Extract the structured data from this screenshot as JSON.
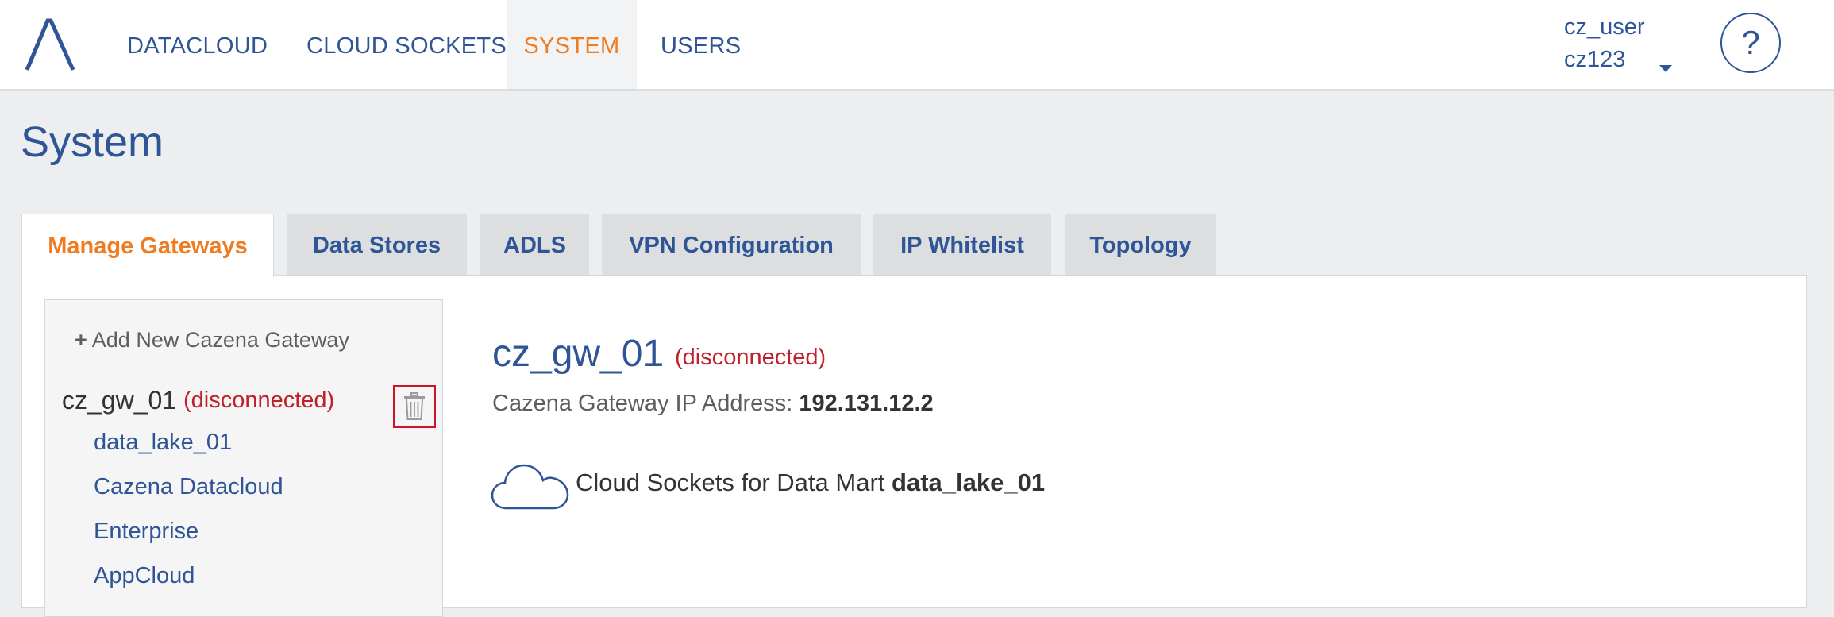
{
  "nav": {
    "items": [
      {
        "label": "DATACLOUD",
        "active": false
      },
      {
        "label": "CLOUD SOCKETS",
        "active": false
      },
      {
        "label": "SYSTEM",
        "active": true
      },
      {
        "label": "USERS",
        "active": false
      }
    ],
    "user": {
      "name": "cz_user",
      "account": "cz123"
    },
    "help_label": "?"
  },
  "page": {
    "title": "System"
  },
  "tabs": [
    {
      "label": "Manage Gateways",
      "active": true
    },
    {
      "label": "Data Stores",
      "active": false
    },
    {
      "label": "ADLS",
      "active": false
    },
    {
      "label": "VPN Configuration",
      "active": false
    },
    {
      "label": "IP Whitelist",
      "active": false
    },
    {
      "label": "Topology",
      "active": false
    }
  ],
  "sidebar": {
    "add_label": "Add New Cazena Gateway",
    "gateway": {
      "name": "cz_gw_01",
      "status": "(disconnected)"
    },
    "links": [
      "data_lake_01",
      "Cazena Datacloud",
      "Enterprise",
      "AppCloud"
    ]
  },
  "detail": {
    "title": "cz_gw_01",
    "status": "(disconnected)",
    "ip_label": "Cazena Gateway IP Address:",
    "ip_value": "192.131.12.2",
    "socket_label": "Cloud Sockets for Data Mart",
    "socket_value": "data_lake_01"
  },
  "colors": {
    "brand": "#2F5597",
    "accent": "#F07C22",
    "error": "#C0202A"
  },
  "icons": {
    "logo": "cazena-logo",
    "help": "help-icon",
    "trash": "trash-icon",
    "cloud": "cloud-icon",
    "add": "plus-icon",
    "menu": "caret-down-icon"
  }
}
